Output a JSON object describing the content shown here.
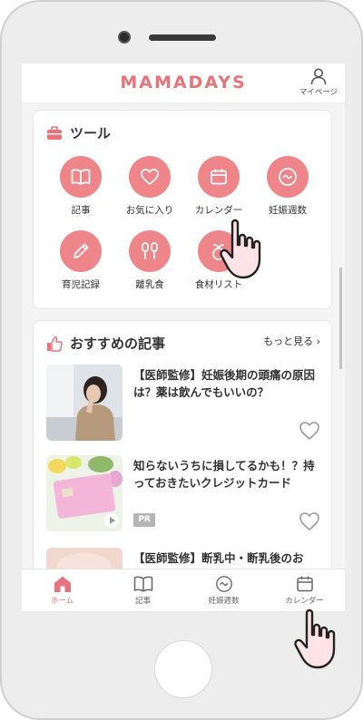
{
  "header": {
    "logo": "MAMADAYS",
    "mypage_label": "マイページ"
  },
  "tools": {
    "title": "ツール",
    "items": [
      {
        "label": "記事",
        "icon": "book-icon"
      },
      {
        "label": "お気に入り",
        "icon": "heart-icon"
      },
      {
        "label": "カレンダー",
        "icon": "calendar-icon"
      },
      {
        "label": "妊娠週数",
        "icon": "baby-icon"
      },
      {
        "label": "育児記録",
        "icon": "pencil-icon"
      },
      {
        "label": "離乳食",
        "icon": "utensils-icon"
      },
      {
        "label": "食材リスト",
        "icon": "vegetable-icon"
      }
    ]
  },
  "articles": {
    "title": "おすすめの記事",
    "more_label": "もっと見る",
    "items": [
      {
        "title": "【医師監修】妊娠後期の頭痛の原因は？薬は飲んでもいいの？",
        "badge": ""
      },
      {
        "title": "知らないうちに損してるかも！？持っておきたいクレジットカード",
        "badge": "PR"
      },
      {
        "title": "【医師監修】断乳中・断乳後のお",
        "badge": ""
      }
    ]
  },
  "tabbar": {
    "tabs": [
      {
        "label": "ホーム",
        "icon": "home-icon",
        "active": true
      },
      {
        "label": "記事",
        "icon": "book-icon",
        "active": false
      },
      {
        "label": "妊娠週数",
        "icon": "baby-icon",
        "active": false
      },
      {
        "label": "カレンダー",
        "icon": "calendar-icon",
        "active": false
      }
    ]
  },
  "colors": {
    "accent": "#ee8589",
    "brand": "#e8737a",
    "background": "#f4f4f4"
  }
}
